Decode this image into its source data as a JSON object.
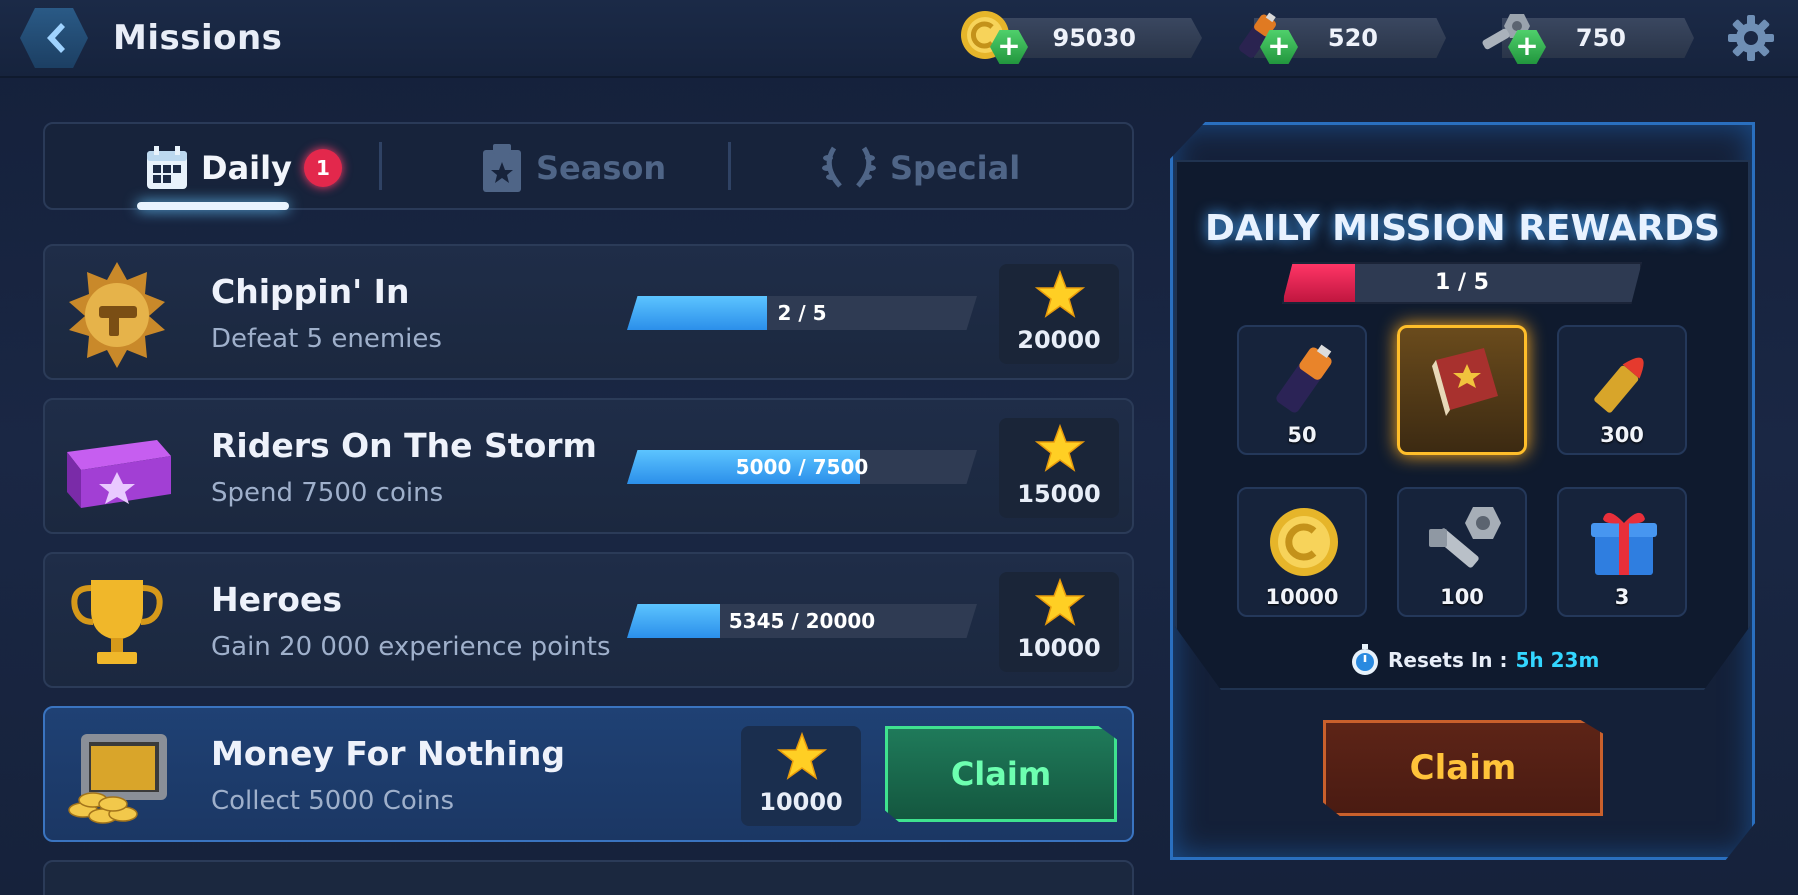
{
  "header": {
    "title": "Missions",
    "currencies": [
      {
        "name": "coins",
        "amount": "95030"
      },
      {
        "name": "batteries",
        "amount": "520"
      },
      {
        "name": "parts",
        "amount": "750"
      }
    ]
  },
  "tabs": [
    {
      "label": "Daily",
      "badge": "1",
      "active": true
    },
    {
      "label": "Season",
      "active": false
    },
    {
      "label": "Special",
      "active": false
    }
  ],
  "missions": [
    {
      "title": "Chippin' In",
      "desc": "Defeat 5 enemies",
      "progress_text": "2 / 5",
      "progress": 0.4,
      "reward": "20000",
      "icon": "gold-badge-icon"
    },
    {
      "title": "Riders On The Storm",
      "desc": "Spend 7500 coins",
      "progress_text": "5000 / 7500",
      "progress": 0.667,
      "reward": "15000",
      "icon": "purple-chest-icon"
    },
    {
      "title": "Heroes",
      "desc": "Gain 20 000 experience points",
      "progress_text": "5345 / 20000",
      "progress": 0.267,
      "reward": "10000",
      "icon": "trophy-icon"
    },
    {
      "title": "Money For Nothing",
      "desc": "Collect 5000 Coins",
      "reward": "10000",
      "claim_label": "Claim",
      "icon": "coin-chest-icon"
    }
  ],
  "panel": {
    "title": "DAILY MISSION REWARDS",
    "progress_text": "1 / 5",
    "progress": 0.2,
    "rewards": [
      {
        "icon": "battery-icon",
        "value": "50"
      },
      {
        "icon": "book-icon",
        "value": ""
      },
      {
        "icon": "bullet-icon",
        "value": "300"
      },
      {
        "icon": "coin-icon",
        "value": "10000"
      },
      {
        "icon": "bolt-icon",
        "value": "100"
      },
      {
        "icon": "gift-icon",
        "value": "3"
      }
    ],
    "resets_label": "Resets In :",
    "resets_time": "5h 23m",
    "claim_label": "Claim"
  },
  "colors": {
    "accent_blue": "#3aa8ff",
    "claim_green": "#3fe28f",
    "claim_orange": "#c9602c",
    "badge_red": "#e3284c"
  }
}
